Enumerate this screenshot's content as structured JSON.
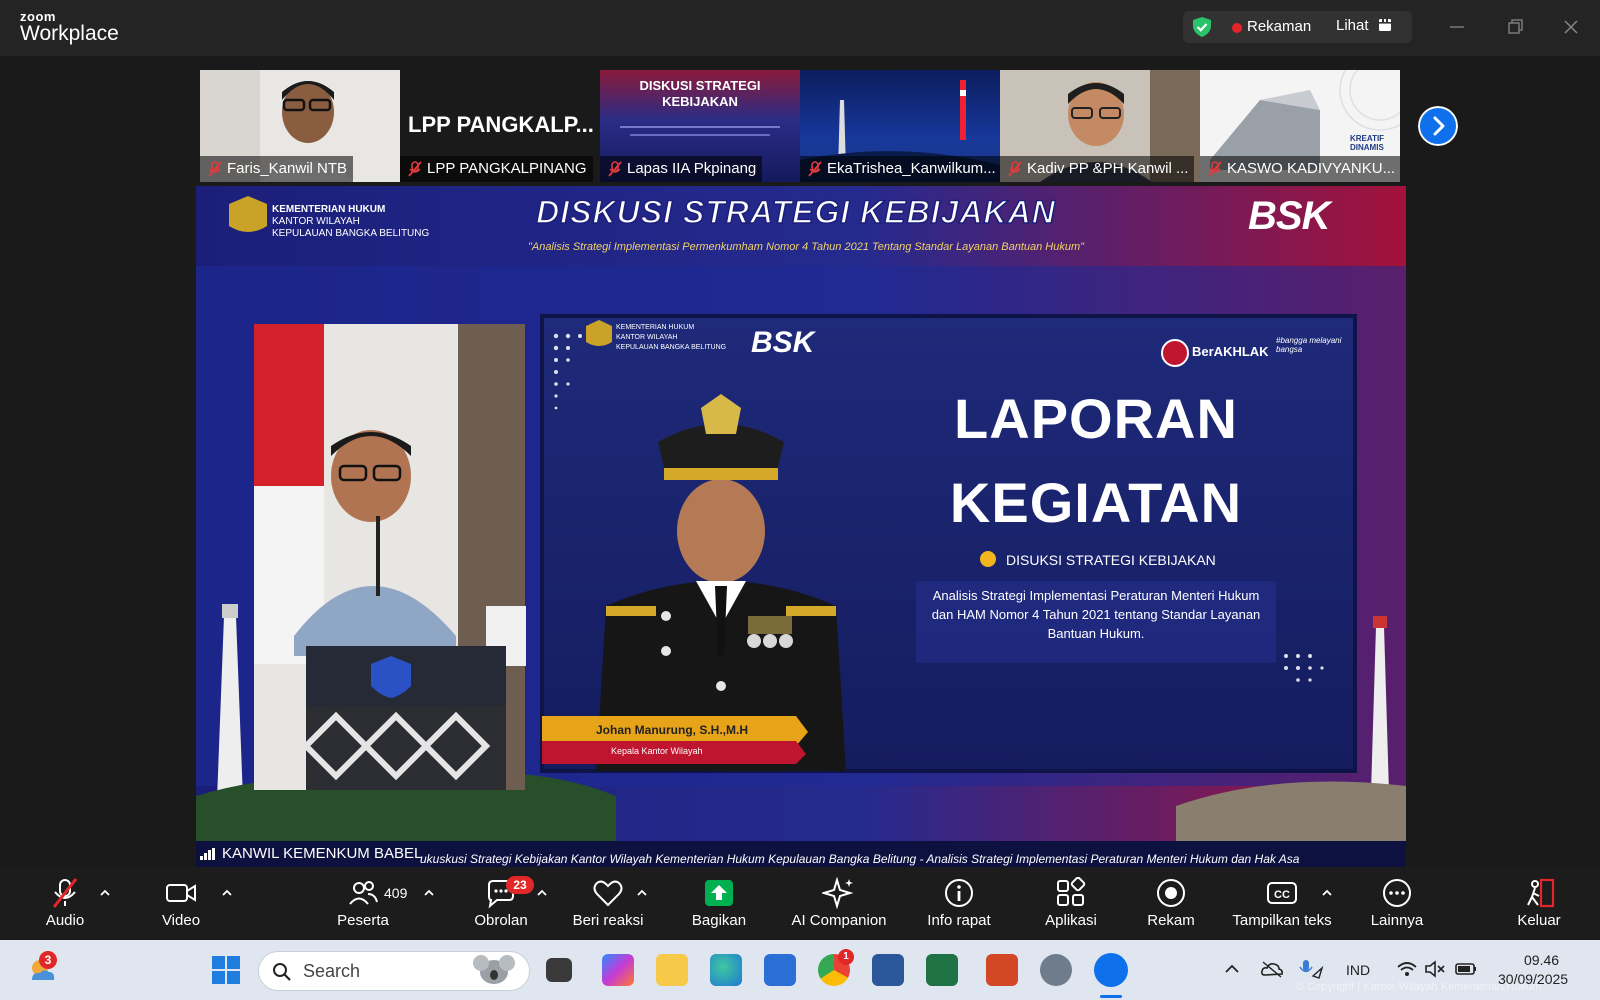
{
  "app": {
    "brand_top": "zoom",
    "brand_bottom": "Workplace"
  },
  "titlebar": {
    "recording_label": "Rekaman",
    "view_label": "Lihat"
  },
  "thumbnails": [
    {
      "name": "Faris_Kanwil NTB",
      "muted": true
    },
    {
      "name": "LPP PANGKALPINANG",
      "muted": true,
      "display_text": "LPP  PANGKALP..."
    },
    {
      "name": "Lapas IIA Pkpinang",
      "muted": true,
      "slide_title": "DISKUSI STRATEGI KEBIJAKAN"
    },
    {
      "name": "EkaTrishea_Kanwilkum...",
      "muted": true
    },
    {
      "name": "Kadiv PP &PH Kanwil ...",
      "muted": true
    },
    {
      "name": "KASWO KADIVYANKU...",
      "muted": true,
      "banner": "KREATIF DINAMIS"
    }
  ],
  "main_video": {
    "participant_label": "KANWIL KEMENKUM BABEL",
    "banner_title": "DISKUSI STRATEGI KEBIJAKAN",
    "banner_subtitle": "\"Analisis Strategi Implementasi Permenkumham Nomor 4 Tahun 2021 Tentang Standar Layanan Bantuan Hukum\"",
    "org_line1": "KEMENTERIAN HUKUM",
    "org_line2": "KANTOR WILAYAH",
    "org_line3": "KEPULAUAN BANGKA BELITUNG",
    "bsk_logo": "BSK",
    "slide": {
      "berakhlak": "BerAKHLAK",
      "bangga": "#bangga melayani bangsa",
      "title_line1": "LAPORAN",
      "title_line2": "KEGIATAN",
      "event": "DISUKSI STRATEGI KEBIJAKAN",
      "description": "Analisis Strategi Implementasi Peraturan Menteri Hukum dan HAM Nomor 4 Tahun 2021 tentang Standar Layanan Bantuan Hukum.",
      "person_name": "Johan Manurung, S.H.,M.H",
      "person_title": "Kepala Kantor Wilayah"
    },
    "ticker": "ukuskusi Strategi Kebijakan Kantor Wilayah Kementerian Hukum Kepulauan Bangka Belitung  - Analisis Strategi Implementasi Peraturan Menteri Hukum dan Hak Asa"
  },
  "controls": {
    "audio": "Audio",
    "video": "Video",
    "participants": "Peserta",
    "participants_count": "409",
    "chat": "Obrolan",
    "chat_badge": "23",
    "react": "Beri reaksi",
    "share": "Bagikan",
    "ai": "AI Companion",
    "info": "Info rapat",
    "apps": "Aplikasi",
    "record": "Rekam",
    "captions": "Tampilkan teks",
    "more": "Lainnya",
    "leave": "Keluar"
  },
  "taskbar": {
    "weather_badge": "3",
    "search_placeholder": "Search",
    "chrome_badge": "1",
    "language": "IND",
    "time": "09.46",
    "date": "30/09/2025",
    "copyright": "© Copyright | Kantor Wilayah Kementerian Hukum"
  },
  "colors": {
    "accent": "#0e71eb",
    "share_green": "#00b050",
    "record_red": "#e5252a",
    "slide_navy": "#1e2a7a",
    "banner_red": "#c0152e"
  }
}
